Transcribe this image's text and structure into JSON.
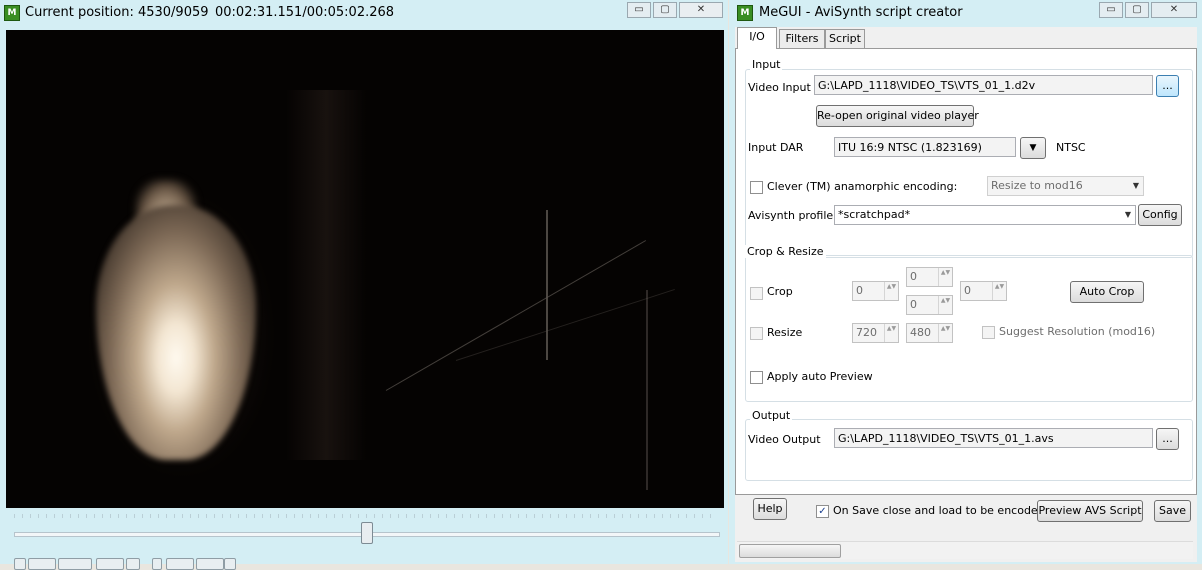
{
  "preview_window": {
    "app_icon": "M",
    "title_position": "Current position: 4530/9059",
    "title_time": "00:02:31.151/00:05:02.268",
    "min_symbol": "▭",
    "max_symbol": "▢",
    "close_symbol": "✕",
    "seek_fraction": 0.5001,
    "nav_buttons": [
      "",
      "",
      "",
      "",
      "",
      "",
      ""
    ]
  },
  "script_window": {
    "app_icon": "M",
    "title": "MeGUI - AviSynth script creator",
    "min_symbol": "▭",
    "max_symbol": "▢",
    "close_symbol": "✕",
    "tabs": {
      "io": "I/O",
      "filters": "Filters",
      "script": "Script"
    },
    "input": {
      "group_label": "Input",
      "video_input_label": "Video Input",
      "video_input_value": "G:\\LAPD_1118\\VIDEO_TS\\VTS_01_1.d2v",
      "browse_label": "...",
      "reopen_label": "Re-open original video player",
      "dar_label": "Input DAR",
      "dar_value": "ITU 16:9 NTSC (1.823169)",
      "dar_dropdown_symbol": "▼",
      "standard": "NTSC",
      "anamorphic_label": "Clever (TM) anamorphic encoding:",
      "anamorphic_mode": "Resize to mod16",
      "profile_label": "Avisynth profile",
      "profile_value": "*scratchpad*",
      "config_label": "Config"
    },
    "crop_resize": {
      "group_label": "Crop & Resize",
      "crop_label": "Crop",
      "crop_left": "0",
      "crop_top": "0",
      "crop_bottom": "0",
      "crop_right": "0",
      "auto_crop_label": "Auto Crop",
      "resize_label": "Resize",
      "width": "720",
      "height": "480",
      "suggest_label": "Suggest Resolution (mod16)",
      "auto_preview_label": "Apply auto Preview",
      "spin_symbol": "▲▼"
    },
    "output": {
      "group_label": "Output",
      "video_output_label": "Video Output",
      "video_output_value": "G:\\LAPD_1118\\VIDEO_TS\\VTS_01_1.avs",
      "browse_label": "..."
    },
    "bottom": {
      "help_label": "Help",
      "close_on_save_label": "On Save close and load to be encoded",
      "close_on_save_checked": true,
      "check_mark": "✓",
      "preview_label": "Preview AVS Script",
      "save_label": "Save"
    }
  }
}
